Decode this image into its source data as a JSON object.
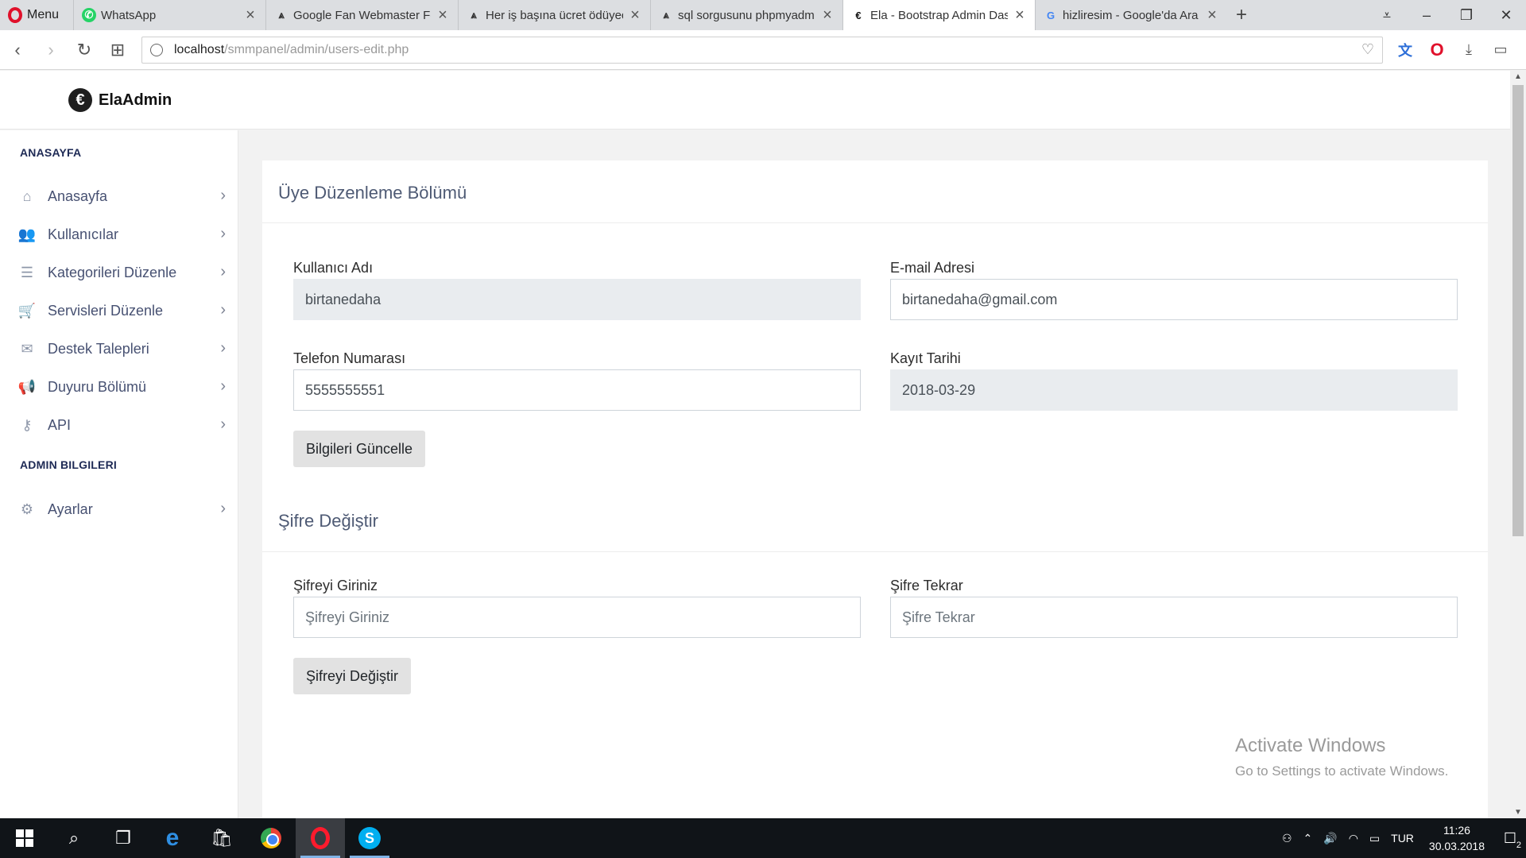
{
  "browser": {
    "menu_label": "Menu",
    "tabs": [
      {
        "title": "WhatsApp",
        "icon": "whatsapp-icon"
      },
      {
        "title": "Google Fan Webmaster Fo",
        "icon": "webmaster-icon"
      },
      {
        "title": "Her iş başına ücret ödüyec",
        "icon": "webmaster-icon"
      },
      {
        "title": "sql sorgusunu phpmyadm",
        "icon": "webmaster-icon"
      },
      {
        "title": "Ela - Bootstrap Admin Das",
        "icon": "ela-icon",
        "active": true
      },
      {
        "title": "hizliresim - Google'da Ara",
        "icon": "google-icon"
      }
    ],
    "url_host": "localhost",
    "url_path": "/smmpanel/admin/users-edit.php"
  },
  "app": {
    "brand": "ElaAdmin",
    "accent_color": "#1e2a55"
  },
  "sidebar": {
    "section1": "ANASAYFA",
    "section2": "ADMIN BILGILERI",
    "items": [
      {
        "label": "Anasayfa",
        "icon": "home-icon"
      },
      {
        "label": "Kullanıcılar",
        "icon": "users-icon"
      },
      {
        "label": "Kategorileri Düzenle",
        "icon": "list-icon"
      },
      {
        "label": "Servisleri Düzenle",
        "icon": "cart-icon"
      },
      {
        "label": "Destek Talepleri",
        "icon": "envelope-icon"
      },
      {
        "label": "Duyuru Bölümü",
        "icon": "bullhorn-icon"
      },
      {
        "label": "API",
        "icon": "key-icon"
      }
    ],
    "admin_items": [
      {
        "label": "Ayarlar",
        "icon": "gear-icon"
      }
    ]
  },
  "user_form": {
    "title": "Üye Düzenleme Bölümü",
    "username_label": "Kullanıcı Adı",
    "username_value": "birtanedaha",
    "email_label": "E-mail Adresi",
    "email_value": "birtanedaha@gmail.com",
    "phone_label": "Telefon Numarası",
    "phone_value": "5555555551",
    "date_label": "Kayıt Tarihi",
    "date_value": "2018-03-29",
    "submit_label": "Bilgileri Güncelle"
  },
  "password_form": {
    "title": "Şifre Değiştir",
    "password_label": "Şifreyi Giriniz",
    "password_placeholder": "Şifreyi Giriniz",
    "confirm_label": "Şifre Tekrar",
    "confirm_placeholder": "Şifre Tekrar",
    "submit_label": "Şifreyi Değiştir"
  },
  "watermark": {
    "line1": "Activate Windows",
    "line2": "Go to Settings to activate Windows."
  },
  "taskbar": {
    "language": "TUR",
    "time": "11:26",
    "date": "30.03.2018",
    "notifications": "2"
  }
}
